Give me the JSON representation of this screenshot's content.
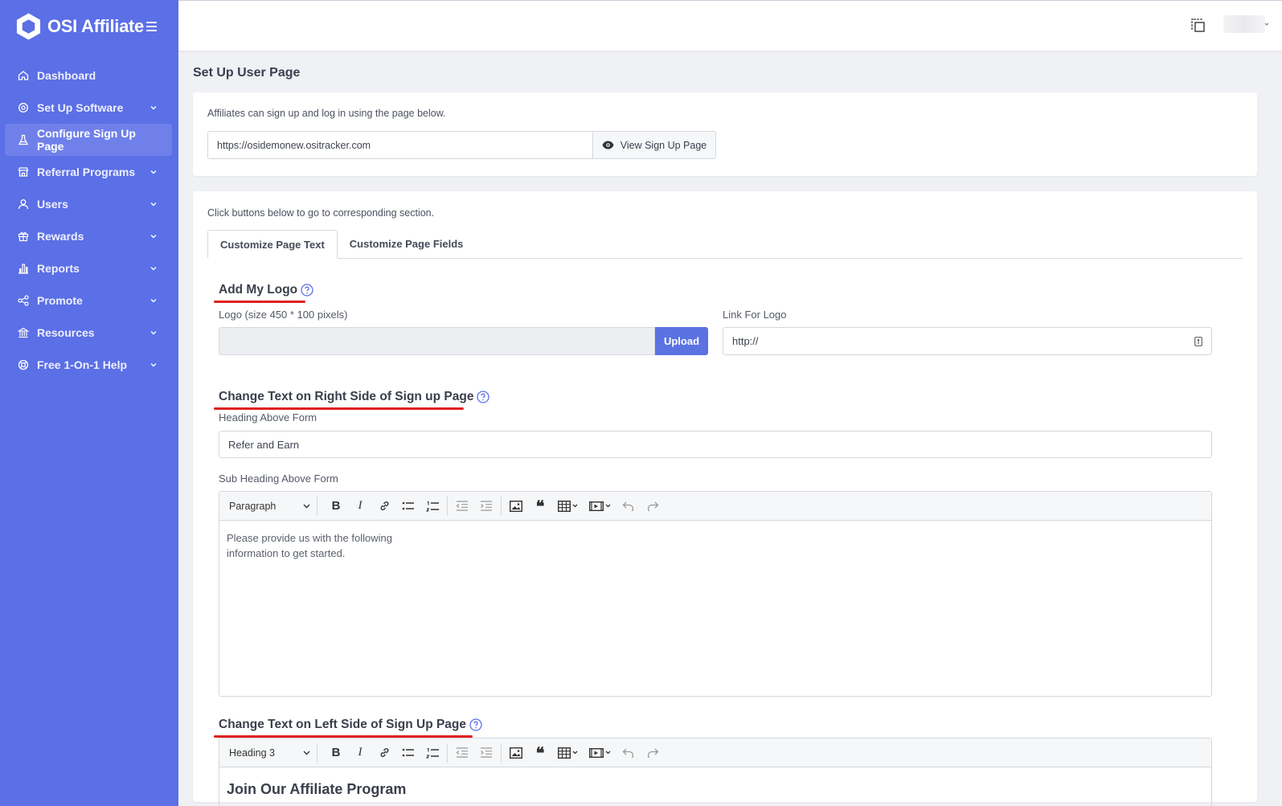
{
  "app": {
    "brand_name": "OSI Affiliate",
    "accent_color": "#5b6fe6"
  },
  "sidebar": {
    "items": [
      {
        "label": "Dashboard",
        "icon": "home-icon",
        "has_chevron": false
      },
      {
        "label": "Set Up Software",
        "icon": "gear-icon",
        "has_chevron": true
      },
      {
        "label": "Configure Sign Up Page",
        "icon": "flask-icon",
        "has_chevron": false,
        "active": true
      },
      {
        "label": "Referral Programs",
        "icon": "store-icon",
        "has_chevron": true
      },
      {
        "label": "Users",
        "icon": "user-icon",
        "has_chevron": true
      },
      {
        "label": "Rewards",
        "icon": "gift-icon",
        "has_chevron": true
      },
      {
        "label": "Reports",
        "icon": "bar-chart-icon",
        "has_chevron": true
      },
      {
        "label": "Promote",
        "icon": "share-icon",
        "has_chevron": true
      },
      {
        "label": "Resources",
        "icon": "bank-icon",
        "has_chevron": true
      },
      {
        "label": "Free 1-On-1 Help",
        "icon": "lifebuoy-icon",
        "has_chevron": true
      }
    ]
  },
  "page": {
    "title": "Set Up User Page"
  },
  "signup_card": {
    "hint": "Affiliates can sign up and log in using the page below.",
    "url_value": "https://osidemonew.ositracker.com",
    "view_button": "View Sign Up Page"
  },
  "config_card": {
    "hint": "Click buttons below to go to corresponding section.",
    "tabs": [
      "Customize Page Text",
      "Customize Page Fields"
    ],
    "logo_section": {
      "title": "Add My Logo",
      "logo_label": "Logo (size 450 * 100 pixels)",
      "upload_button": "Upload",
      "link_label": "Link For Logo",
      "link_value": "http://"
    },
    "right_section": {
      "title": "Change Text on Right Side of Sign up Page",
      "heading_label": "Heading Above Form",
      "heading_value": "Refer and Earn",
      "subheading_label": "Sub Heading Above Form",
      "editor_format": "Paragraph",
      "editor_text": "Please provide us with the following information to get started."
    },
    "left_section": {
      "title": "Change Text on Left Side of Sign Up Page",
      "editor_format": "Heading 3",
      "editor_text": "Join Our Affiliate Program"
    }
  }
}
